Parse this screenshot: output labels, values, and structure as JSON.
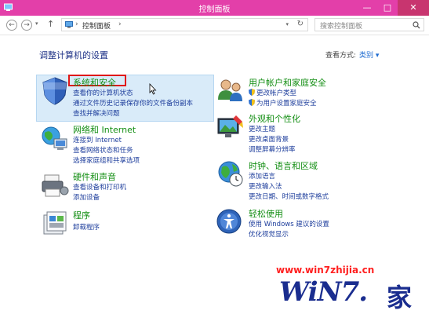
{
  "window": {
    "title": "控制面板",
    "minimize": "—",
    "maximize": "□",
    "close": "✕"
  },
  "nav": {
    "back": "←",
    "forward": "→",
    "up": "↑",
    "address": "控制面板",
    "address_sep": "›",
    "refresh": "↻",
    "search_placeholder": "搜索控制面板"
  },
  "header": {
    "title": "调整计算机的设置",
    "view_label": "查看方式:",
    "view_value": "类别 ▾"
  },
  "left_categories": [
    {
      "title": "系统和安全",
      "links": [
        "查看你的计算机状态",
        "通过文件历史记录保存你的文件备份副本",
        "查找并解决问题"
      ]
    },
    {
      "title": "网络和 Internet",
      "links": [
        "连接到 Internet",
        "查看网络状态和任务",
        "选择家庭组和共享选项"
      ]
    },
    {
      "title": "硬件和声音",
      "links": [
        "查看设备和打印机",
        "添加设备"
      ]
    },
    {
      "title": "程序",
      "links": [
        "卸载程序"
      ]
    }
  ],
  "right_categories": [
    {
      "title": "用户帐户和家庭安全",
      "links": [
        "更改帐户类型",
        "为用户设置家庭安全"
      ]
    },
    {
      "title": "外观和个性化",
      "links": [
        "更改主题",
        "更改桌面背景",
        "调整屏幕分辨率"
      ]
    },
    {
      "title": "时钟、语言和区域",
      "links": [
        "添加语言",
        "更改输入法",
        "更改日期、时间或数字格式"
      ]
    },
    {
      "title": "轻松使用",
      "links": [
        "使用 Windows 建议的设置",
        "优化视觉显示"
      ]
    }
  ],
  "watermark": {
    "url": "www.win7zhijia.cn",
    "logo": "WiN7.",
    "jia": "家"
  },
  "colors": {
    "titlebar": "#e33fa9",
    "category_heading": "#138e13",
    "link": "#1e3e9c",
    "highlight": "#d9ebf9",
    "red_box": "#e01818"
  }
}
